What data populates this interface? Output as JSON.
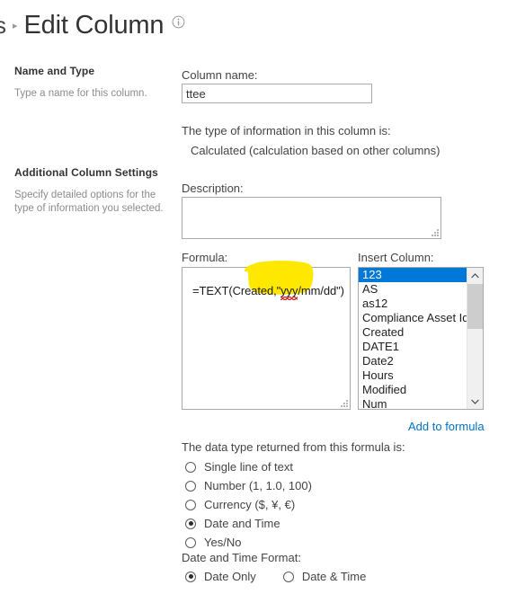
{
  "header": {
    "breadcrumb_truncated": "s",
    "separator": "▸",
    "title": "Edit Column",
    "info_icon_title": "Information"
  },
  "sections": [
    {
      "title": "Name and Type",
      "description": "Type a name for this column."
    },
    {
      "title": "Additional Column Settings",
      "description": "Specify detailed options for the type of information you selected."
    }
  ],
  "form": {
    "column_name_label": "Column name:",
    "column_name_value": "ttee",
    "column_name_placeholder": "",
    "type_info_label": "The type of information in this column is:",
    "type_info_value": "Calculated (calculation based on other columns)",
    "description_label": "Description:",
    "description_value": "",
    "description_placeholder": "",
    "formula_label": "Formula:",
    "formula_value": "=TEXT(Created,\"yyy/mm/dd\")",
    "formula_parts": {
      "before": "=TEXT(Created,\"",
      "misspelled": "yyy",
      "after": "/mm/dd\")"
    },
    "insert_column_label": "Insert Column:",
    "insert_column_options": [
      "123",
      "AS",
      "as12",
      "Compliance Asset Id",
      "Created",
      "DATE1",
      "Date2",
      "Hours",
      "Modified",
      "Num"
    ],
    "insert_column_selected": "123",
    "add_to_formula_label": "Add to formula",
    "return_type_label": "The data type returned from this formula is:",
    "return_type_options": [
      {
        "label": "Single line of text",
        "checked": false
      },
      {
        "label": "Number (1, 1.0, 100)",
        "checked": false
      },
      {
        "label": "Currency ($, ¥, €)",
        "checked": false
      },
      {
        "label": "Date and Time",
        "checked": true
      },
      {
        "label": "Yes/No",
        "checked": false
      }
    ],
    "datetime_format_label": "Date and Time Format:",
    "datetime_format_options": [
      {
        "label": "Date Only",
        "checked": true
      },
      {
        "label": "Date & Time",
        "checked": false
      }
    ]
  },
  "annotation": {
    "highlight_color": "#FFE800",
    "spellcheck_underline_color": "#D32020"
  },
  "colors": {
    "accent_link": "#0072C6",
    "selection_blue": "#0078D7",
    "border_gray": "#A9A9A9",
    "muted_text": "#8C8C8C"
  }
}
